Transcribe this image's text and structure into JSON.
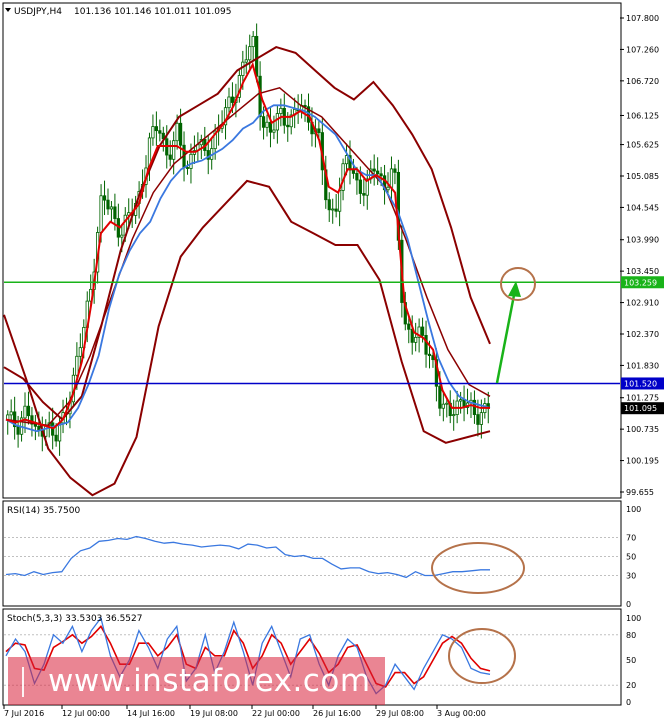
{
  "header": {
    "symbol": "USDJPY,H4",
    "ohlc": "101.136 101.146 101.011 101.095"
  },
  "colors": {
    "background": "#ffffff",
    "frame": "#000000",
    "grid": "#c0c0c0",
    "candle": "#006400",
    "sma": "#e00000",
    "ema": "#3a78e0",
    "bollinger": "#8b0000",
    "level_green": "#19b319",
    "level_blue": "#0000c8",
    "level_current": "#000000",
    "arrow": "#19b319",
    "ellipse": "#b5724a",
    "stoch_main": "#3a78e0",
    "stoch_signal": "#e00000",
    "rsi": "#3a78e0",
    "watermark": "#d9213a"
  },
  "chart_data": [
    {
      "type": "candlestick",
      "title": "USDJPY,H4",
      "ohlc_label": "101.136 101.146 101.011 101.095",
      "y_ticks": [
        "107.800",
        "107.260",
        "106.720",
        "106.125",
        "105.625",
        "105.085",
        "104.545",
        "103.990",
        "103.450",
        "102.910",
        "102.370",
        "101.830",
        "101.275",
        "100.735",
        "100.195",
        "99.655"
      ],
      "ylim": [
        99.655,
        107.8
      ],
      "x_ticks": [
        "7 Jul 2016",
        "12 Jul 00:00",
        "14 Jul 16:00",
        "19 Jul 08:00",
        "22 Jul 00:00",
        "26 Jul 16:00",
        "29 Jul 08:00",
        "3 Aug 00:00"
      ],
      "levels": [
        {
          "name": "resistance",
          "value": 103.259,
          "label": "103.259"
        },
        {
          "name": "support",
          "value": 101.52,
          "label": "101.520"
        },
        {
          "name": "current",
          "value": 101.095,
          "label": "101.095"
        }
      ],
      "close_path": [
        100.9,
        100.8,
        101.1,
        100.6,
        100.9,
        100.5,
        101.0,
        101.6,
        102.4,
        103.4,
        104.7,
        104.5,
        104.1,
        104.4,
        104.8,
        105.6,
        106.0,
        105.4,
        105.8,
        105.2,
        105.7,
        105.4,
        105.8,
        106.1,
        106.5,
        107.0,
        107.4,
        106.0,
        105.8,
        106.2,
        106.0,
        106.3,
        106.1,
        105.7,
        104.4,
        104.7,
        105.4,
        105.0,
        104.8,
        105.3,
        104.9,
        105.2,
        102.6,
        102.3,
        102.3,
        102.0,
        101.0,
        101.1,
        101.2,
        101.1,
        101.0,
        101.1
      ],
      "sma_path": [
        100.9,
        100.85,
        100.9,
        100.85,
        100.8,
        100.75,
        100.9,
        101.3,
        101.9,
        102.9,
        104.1,
        104.3,
        104.2,
        104.4,
        104.6,
        105.2,
        105.6,
        105.6,
        105.6,
        105.5,
        105.5,
        105.6,
        105.8,
        106.0,
        106.3,
        106.7,
        107.0,
        106.4,
        106.0,
        106.1,
        106.1,
        106.2,
        106.1,
        105.7,
        104.9,
        104.8,
        105.2,
        105.2,
        105.0,
        105.1,
        105.0,
        104.8,
        102.9,
        102.4,
        102.3,
        102.1,
        101.4,
        101.1,
        101.1,
        101.15,
        101.1,
        101.1
      ],
      "ema_path": [
        100.9,
        100.8,
        100.75,
        100.7,
        100.75,
        100.8,
        100.85,
        101.1,
        101.5,
        102.0,
        102.8,
        103.4,
        103.8,
        104.1,
        104.3,
        104.7,
        105.0,
        105.2,
        105.3,
        105.35,
        105.45,
        105.55,
        105.7,
        105.9,
        106.0,
        106.2,
        106.3,
        106.3,
        106.25,
        106.2,
        106.1,
        105.95,
        105.8,
        105.5,
        105.2,
        105.1,
        105.1,
        104.8,
        104.5,
        104.0,
        103.3,
        102.6,
        101.95,
        101.55,
        101.3,
        101.2,
        101.15,
        101.1
      ],
      "bollinger_upper": [
        101.8,
        101.6,
        101.2,
        100.9,
        101.3,
        102.5,
        103.8,
        104.8,
        105.6,
        106.1,
        106.3,
        106.5,
        106.9,
        107.1,
        107.3,
        107.2,
        106.9,
        106.6,
        106.4,
        106.7,
        106.3,
        105.8,
        105.2,
        104.2,
        103.0,
        102.2
      ],
      "bollinger_middle": [
        100.9,
        100.85,
        100.8,
        101.2,
        102.0,
        103.0,
        104.0,
        104.8,
        105.3,
        105.6,
        105.9,
        106.2,
        106.5,
        106.6,
        106.3,
        106.1,
        105.7,
        105.3,
        104.9,
        104.0,
        103.0,
        102.1,
        101.5,
        101.3
      ],
      "bollinger_lower": [
        102.7,
        101.6,
        100.4,
        99.9,
        99.6,
        99.8,
        100.6,
        102.5,
        103.7,
        104.2,
        104.6,
        105.0,
        104.9,
        104.3,
        104.1,
        103.9,
        103.9,
        103.3,
        101.9,
        100.7,
        100.5,
        100.6,
        100.7
      ]
    },
    {
      "type": "line",
      "title": "RSI(14) 35.7500",
      "ylim": [
        0,
        100
      ],
      "y_ticks": [
        "100",
        "70",
        "50",
        "30",
        "0"
      ],
      "levels": [
        70,
        50,
        30
      ],
      "series": [
        {
          "name": "RSI(14)",
          "values": [
            31,
            32,
            30,
            34,
            31,
            33,
            34,
            48,
            56,
            59,
            66,
            67,
            69,
            68,
            71,
            69,
            66,
            64,
            65,
            63,
            62,
            60,
            61,
            62,
            61,
            58,
            63,
            62,
            59,
            60,
            52,
            50,
            51,
            48,
            48,
            42,
            37,
            38,
            38,
            34,
            32,
            33,
            31,
            28,
            34,
            30,
            30,
            32,
            34,
            34,
            35,
            36,
            36
          ]
        }
      ]
    },
    {
      "type": "line",
      "title": "Stoch(5,3,3) 33.5303 36.5527",
      "ylim": [
        0,
        100
      ],
      "y_ticks": [
        "100",
        "80",
        "50",
        "20",
        "0"
      ],
      "levels": [
        80,
        20
      ],
      "series": [
        {
          "name": "main",
          "values": [
            55,
            75,
            60,
            22,
            45,
            80,
            70,
            90,
            60,
            85,
            100,
            55,
            30,
            50,
            85,
            65,
            40,
            75,
            90,
            25,
            40,
            80,
            35,
            60,
            95,
            60,
            20,
            70,
            90,
            60,
            30,
            75,
            80,
            45,
            20,
            55,
            75,
            65,
            30,
            10,
            20,
            45,
            30,
            15,
            40,
            60,
            80,
            75,
            65,
            40,
            35,
            33
          ]
        },
        {
          "name": "signal",
          "values": [
            60,
            70,
            68,
            40,
            38,
            65,
            72,
            80,
            70,
            78,
            90,
            70,
            45,
            45,
            70,
            70,
            55,
            65,
            80,
            45,
            40,
            65,
            55,
            55,
            85,
            70,
            40,
            55,
            80,
            70,
            45,
            60,
            75,
            58,
            35,
            45,
            65,
            68,
            45,
            22,
            18,
            35,
            35,
            22,
            30,
            50,
            70,
            78,
            70,
            52,
            40,
            37
          ]
        }
      ]
    }
  ],
  "watermark": "www.instaforex.com"
}
